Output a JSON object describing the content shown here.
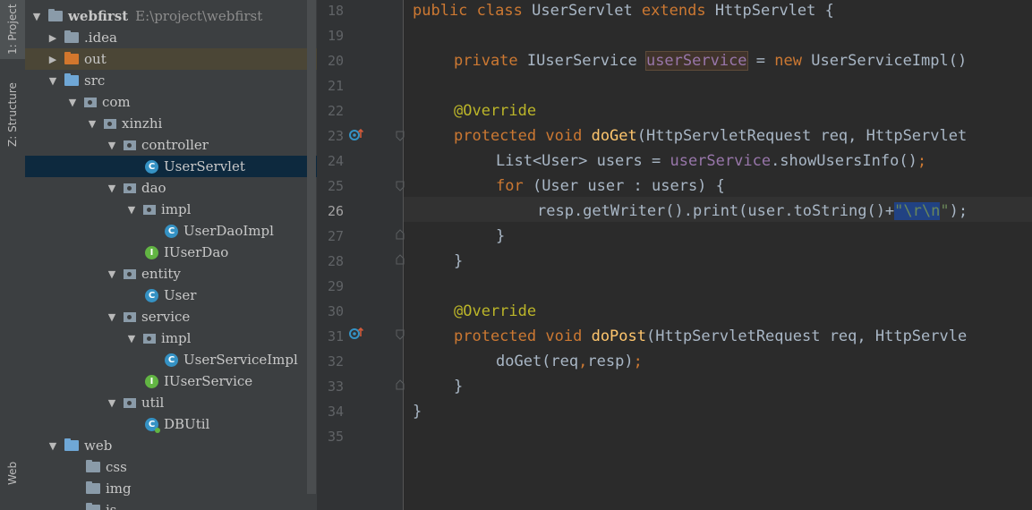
{
  "tool_strip": {
    "project_tab": "1: Project",
    "structure_tab": "Z: Structure",
    "web_tab": "Web"
  },
  "project_tree": [
    {
      "label": "webfirst",
      "detail": "E:\\project\\webfirst",
      "icon": "module-folder-icon",
      "expanded": true
    },
    {
      "label": ".idea",
      "icon": "folder-icon",
      "expanded": false
    },
    {
      "label": "out",
      "icon": "excluded-folder-icon",
      "expanded": false
    },
    {
      "label": "src",
      "icon": "source-folder-icon",
      "expanded": true
    },
    {
      "label": "com",
      "icon": "package-icon",
      "expanded": true
    },
    {
      "label": "xinzhi",
      "icon": "package-icon",
      "expanded": true
    },
    {
      "label": "controller",
      "icon": "package-icon",
      "expanded": true
    },
    {
      "label": "UserServlet",
      "icon": "class-icon",
      "badge": "C",
      "selected": true
    },
    {
      "label": "dao",
      "icon": "package-icon",
      "expanded": true
    },
    {
      "label": "impl",
      "icon": "package-icon",
      "expanded": true
    },
    {
      "label": "UserDaoImpl",
      "icon": "class-icon",
      "badge": "C"
    },
    {
      "label": "IUserDao",
      "icon": "interface-icon",
      "badge": "I"
    },
    {
      "label": "entity",
      "icon": "package-icon",
      "expanded": true
    },
    {
      "label": "User",
      "icon": "class-icon",
      "badge": "C"
    },
    {
      "label": "service",
      "icon": "package-icon",
      "expanded": true
    },
    {
      "label": "impl",
      "icon": "package-icon",
      "expanded": true
    },
    {
      "label": "UserServiceImpl",
      "icon": "class-icon",
      "badge": "C"
    },
    {
      "label": "IUserService",
      "icon": "interface-icon",
      "badge": "I"
    },
    {
      "label": "util",
      "icon": "package-icon",
      "expanded": true
    },
    {
      "label": "DBUtil",
      "icon": "runnable-class-icon",
      "badge": "C"
    },
    {
      "label": "web",
      "icon": "web-folder-icon",
      "expanded": true
    },
    {
      "label": "css",
      "icon": "folder-icon"
    },
    {
      "label": "img",
      "icon": "folder-icon"
    },
    {
      "label": "js",
      "icon": "folder-icon"
    }
  ],
  "editor": {
    "current_line": "26",
    "line_numbers": [
      "18",
      "19",
      "20",
      "21",
      "22",
      "23",
      "24",
      "25",
      "26",
      "27",
      "28",
      "29",
      "30",
      "31",
      "32",
      "33",
      "34",
      "35"
    ],
    "code": {
      "l18": {
        "kw1": "public",
        "t1": " ",
        "kw2": "class",
        "t2": " UserServlet ",
        "kw3": "extends",
        "t3": " HttpServlet {"
      },
      "l20": {
        "kw1": "private",
        "t1": " IUserService ",
        "usage": "userService",
        "t2": " = ",
        "kw2": "new",
        "t3": " UserServiceImpl()"
      },
      "l22": {
        "ann": "@Override"
      },
      "l23": {
        "kw1": "protected",
        "t1": " ",
        "kw2": "void",
        "t2": " ",
        "fn": "doGet",
        "t3": "(HttpServletRequest req, HttpServlet"
      },
      "l24": {
        "t1": "List<User> users = ",
        "fld": "userService",
        "t2": ".showUsersInfo()",
        "semi": ";"
      },
      "l25": {
        "kw1": "for",
        "t1": " (User user : users) {"
      },
      "l26": {
        "t1": "resp.getWriter().print(user.toString()+",
        "q1": "\"",
        "sel": "\\r\\n",
        "q2": "\"",
        "t2": ");"
      },
      "l27": {
        "t1": "}"
      },
      "l28": {
        "t1": "}"
      },
      "l30": {
        "ann": "@Override"
      },
      "l31": {
        "kw1": "protected",
        "t1": " ",
        "kw2": "void",
        "t2": " ",
        "fn": "doPost",
        "t3": "(HttpServletRequest req, HttpServle"
      },
      "l32": {
        "t1": "doGet(req",
        "comma": ",",
        "t2": "resp)",
        "semi": ";"
      },
      "l33": {
        "t1": "}"
      },
      "l34": {
        "t1": "}"
      }
    }
  },
  "colors": {
    "keyword": "#cc7832",
    "annotation": "#bbb529",
    "method": "#ffc66d",
    "field": "#9876aa",
    "string": "#6a8759",
    "selection": "#214283"
  }
}
